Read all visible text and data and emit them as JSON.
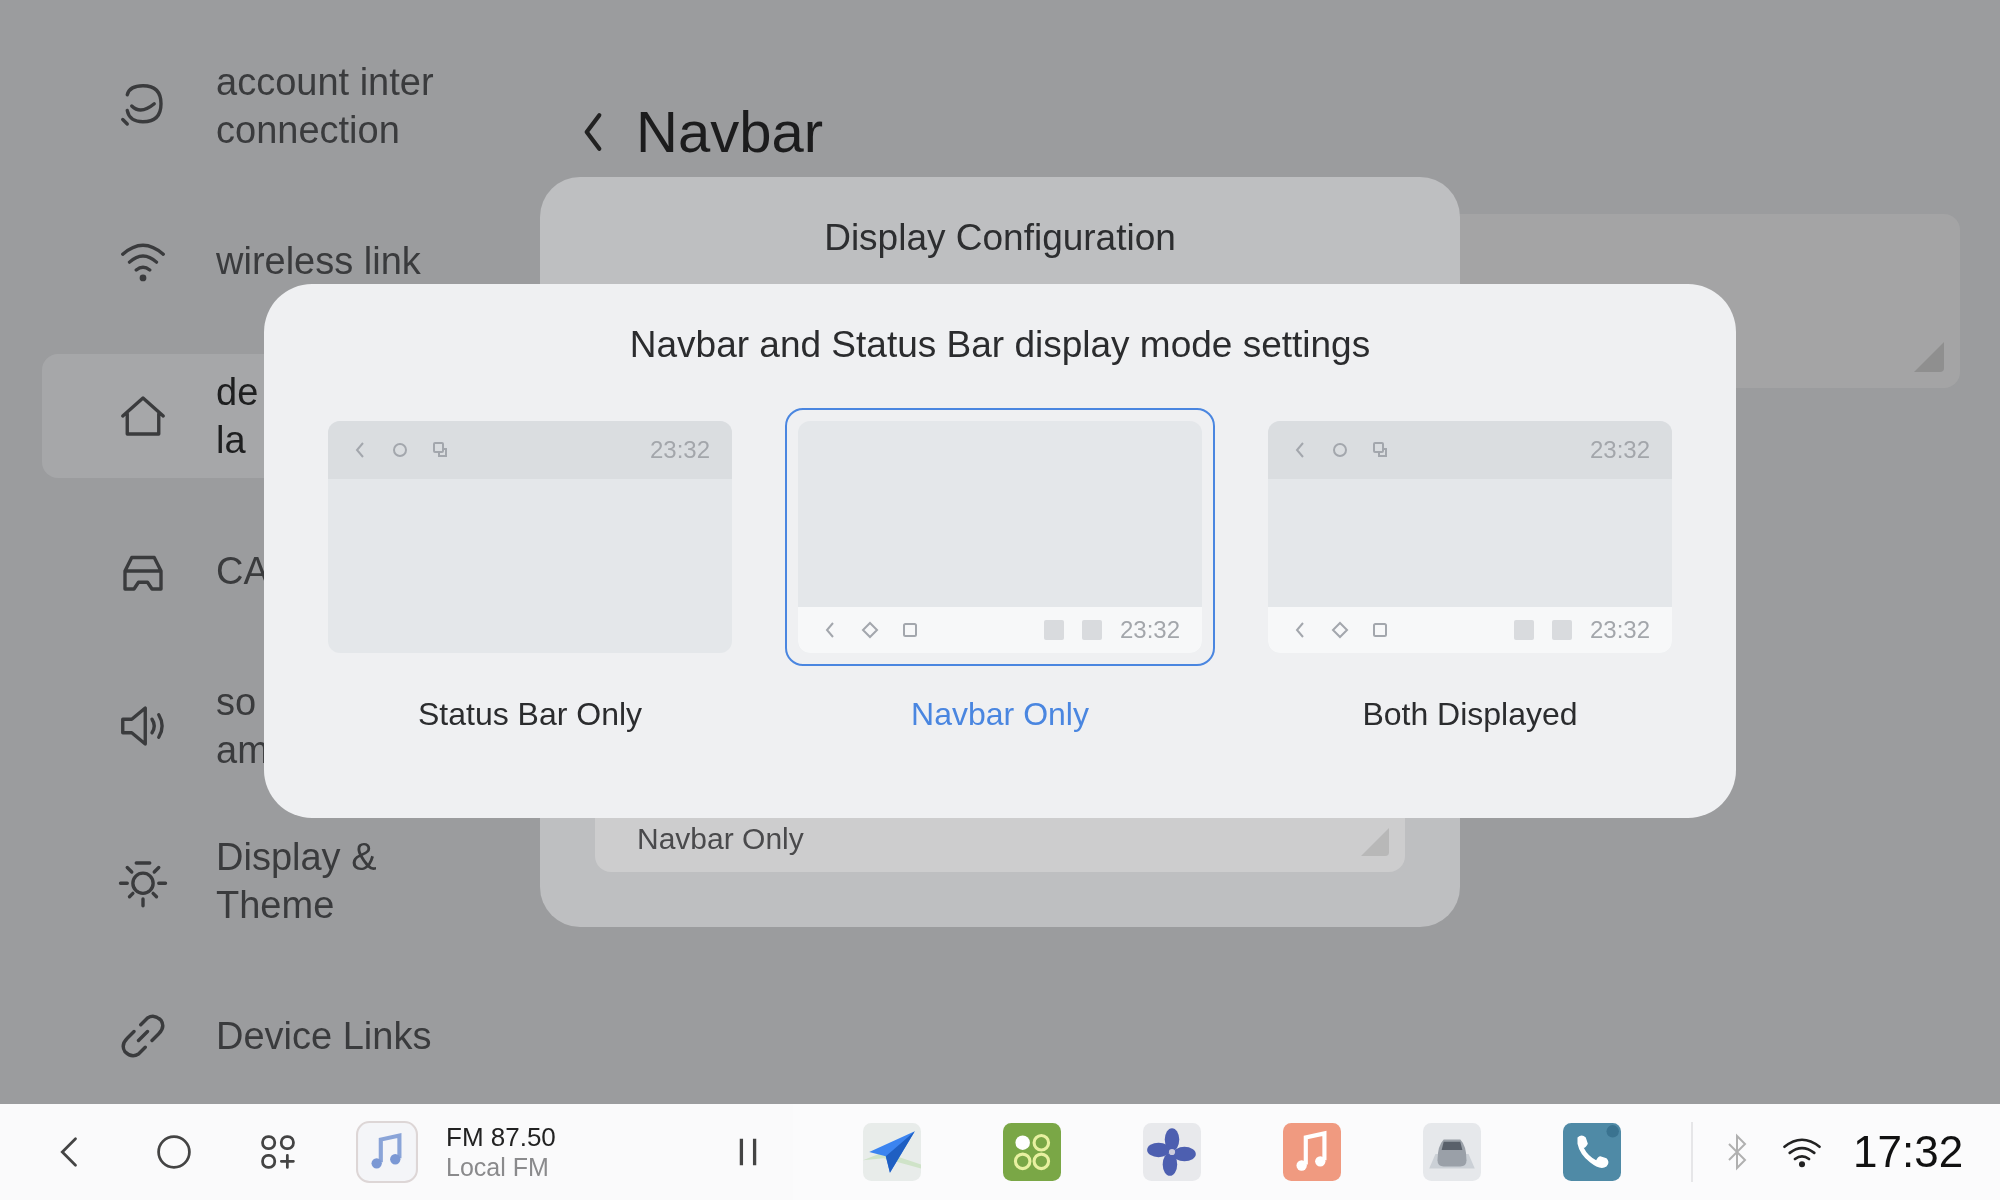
{
  "sidebar": {
    "items": [
      {
        "lines": [
          "account inter",
          "connection"
        ],
        "selected": false
      },
      {
        "lines": [
          "wireless link"
        ],
        "selected": false
      },
      {
        "lines": [
          "de",
          "la"
        ],
        "selected": true
      },
      {
        "lines": [
          "CA"
        ],
        "selected": false
      },
      {
        "lines": [
          "so",
          "am"
        ],
        "selected": false
      },
      {
        "lines": [
          "Display &",
          "Theme"
        ],
        "selected": false
      },
      {
        "lines": [
          "Device Links"
        ],
        "selected": false
      }
    ]
  },
  "header": {
    "title": "Navbar"
  },
  "background_dialog": {
    "title": "Display Configuration",
    "field_value": "Navbar Only"
  },
  "modal": {
    "title": "Navbar and Status Bar display mode settings",
    "options": [
      {
        "kind": "status",
        "label": "Status Bar Only",
        "status_time": "23:32",
        "selected": false
      },
      {
        "kind": "navbar",
        "label": "Navbar Only",
        "nav_time": "23:32",
        "selected": true
      },
      {
        "kind": "both",
        "label": "Both Displayed",
        "status_time": "23:32",
        "nav_time": "23:32",
        "selected": false
      }
    ]
  },
  "taskbar": {
    "media": {
      "station": "FM 87.50",
      "source": "Local FM"
    },
    "time": "17:32"
  }
}
